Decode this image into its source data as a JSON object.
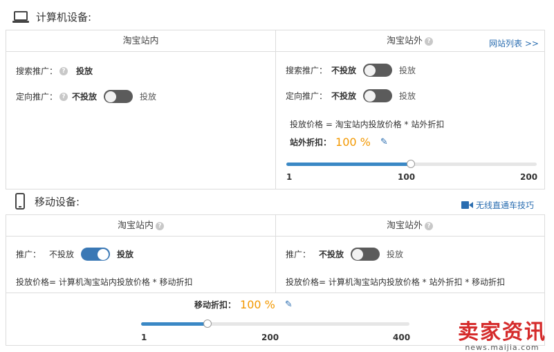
{
  "computer": {
    "title": "计算机设备:",
    "inside": {
      "header": "淘宝站内",
      "search_label": "搜索推广：",
      "search_value": "投放",
      "target_label": "定向推广：",
      "target_off": "不投放",
      "target_on": "投放"
    },
    "outside": {
      "header": "淘宝站外",
      "site_list_link": "网站列表 >>",
      "search_label": "搜索推广：",
      "search_off": "不投放",
      "search_on": "投放",
      "target_label": "定向推广：",
      "target_off": "不投放",
      "target_on": "投放",
      "formula": "投放价格 = 淘宝站内投放价格 * 站外折扣",
      "discount_label": "站外折扣：",
      "discount_value": "100 %",
      "slider": {
        "min_label": "1",
        "mid_label": "100",
        "max_label": "200",
        "value": 100,
        "min": 1,
        "max": 200
      }
    }
  },
  "mobile": {
    "title": "移动设备:",
    "tips_link": "无线直通车技巧",
    "inside": {
      "header": "淘宝站内",
      "promo_label": "推广：",
      "promo_off": "不投放",
      "promo_on": "投放",
      "formula": "投放价格= 计算机淘宝站内投放价格 * 移动折扣"
    },
    "outside": {
      "header": "淘宝站外",
      "promo_label": "推广：",
      "promo_off": "不投放",
      "promo_on": "投放",
      "formula": "投放价格= 计算机淘宝站内投放价格 * 站外折扣 * 移动折扣"
    },
    "discount_label": "移动折扣：",
    "discount_value": "100 %",
    "slider": {
      "min_label": "1",
      "mid_label": "200",
      "max_label": "400",
      "value": 100,
      "min": 1,
      "max": 400
    }
  },
  "watermark": {
    "main": "卖家资讯",
    "sub": "news.maijia.com"
  },
  "colors": {
    "accent": "#3a88c5",
    "price": "#f39800",
    "link": "#2a6db0",
    "toggle_off": "#5b5b5b",
    "toggle_on": "#3a78b5"
  }
}
